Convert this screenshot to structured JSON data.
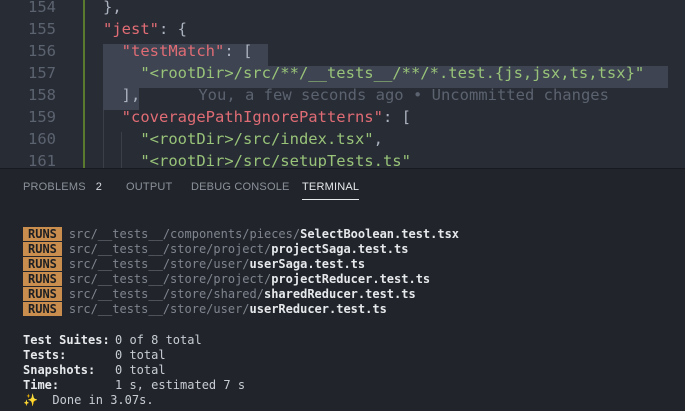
{
  "editor": {
    "lines": [
      {
        "num": "154",
        "tokens": [
          {
            "t": "},",
            "c": "p"
          }
        ]
      },
      {
        "num": "155",
        "tokens": [
          {
            "t": "\"jest\"",
            "c": "k"
          },
          {
            "t": ": {",
            "c": "p"
          }
        ]
      },
      {
        "num": "156",
        "tokens": [
          {
            "t": "  ",
            "c": "p"
          },
          {
            "t": "\"testMatch\"",
            "c": "k"
          },
          {
            "t": ": [",
            "c": "p"
          }
        ]
      },
      {
        "num": "157",
        "tokens": [
          {
            "t": "    ",
            "c": "p"
          },
          {
            "t": "\"<rootDir>/src/**/__tests__/**/*.test.{js,jsx,ts,tsx}\"",
            "c": "s"
          }
        ]
      },
      {
        "num": "158",
        "tokens": [
          {
            "t": "  ",
            "c": "p"
          },
          {
            "t": "],",
            "c": "p"
          }
        ]
      },
      {
        "num": "159",
        "tokens": [
          {
            "t": "  ",
            "c": "p"
          },
          {
            "t": "\"coveragePathIgnorePatterns\"",
            "c": "k"
          },
          {
            "t": ": [",
            "c": "p"
          }
        ]
      },
      {
        "num": "160",
        "tokens": [
          {
            "t": "    ",
            "c": "p"
          },
          {
            "t": "\"<rootDir>/src/index.tsx\"",
            "c": "s"
          },
          {
            "t": ",",
            "c": "p"
          }
        ]
      },
      {
        "num": "161",
        "tokens": [
          {
            "t": "    ",
            "c": "p"
          },
          {
            "t": "\"<rootDir>/src/setupTests.ts\"",
            "c": "s"
          }
        ]
      }
    ],
    "blame": "You, a few seconds ago • Uncommitted changes"
  },
  "panel": {
    "tabs": [
      {
        "label": "PROBLEMS",
        "badge": "2"
      },
      {
        "label": "OUTPUT"
      },
      {
        "label": "DEBUG CONSOLE"
      },
      {
        "label": "TERMINAL"
      }
    ],
    "active_tab": "TERMINAL"
  },
  "terminal": {
    "runs_label": "RUNS",
    "runs": [
      {
        "dir": "src/__tests__/components/pieces/",
        "file": "SelectBoolean.test.tsx"
      },
      {
        "dir": "src/__tests__/store/project/",
        "file": "projectSaga.test.ts"
      },
      {
        "dir": "src/__tests__/store/user/",
        "file": "userSaga.test.ts"
      },
      {
        "dir": "src/__tests__/store/project/",
        "file": "projectReducer.test.ts"
      },
      {
        "dir": "src/__tests__/store/shared/",
        "file": "sharedReducer.test.ts"
      },
      {
        "dir": "src/__tests__/store/user/",
        "file": "userReducer.test.ts"
      }
    ],
    "summary": [
      {
        "label": "Test Suites:",
        "value": "0 of 8 total"
      },
      {
        "label": "Tests:",
        "value": "0 total"
      },
      {
        "label": "Snapshots:",
        "value": "0 total"
      },
      {
        "label": "Time:",
        "value": "1 s, estimated 7 s"
      }
    ],
    "done_icon": "✨",
    "done_text": "Done in 3.07s."
  }
}
